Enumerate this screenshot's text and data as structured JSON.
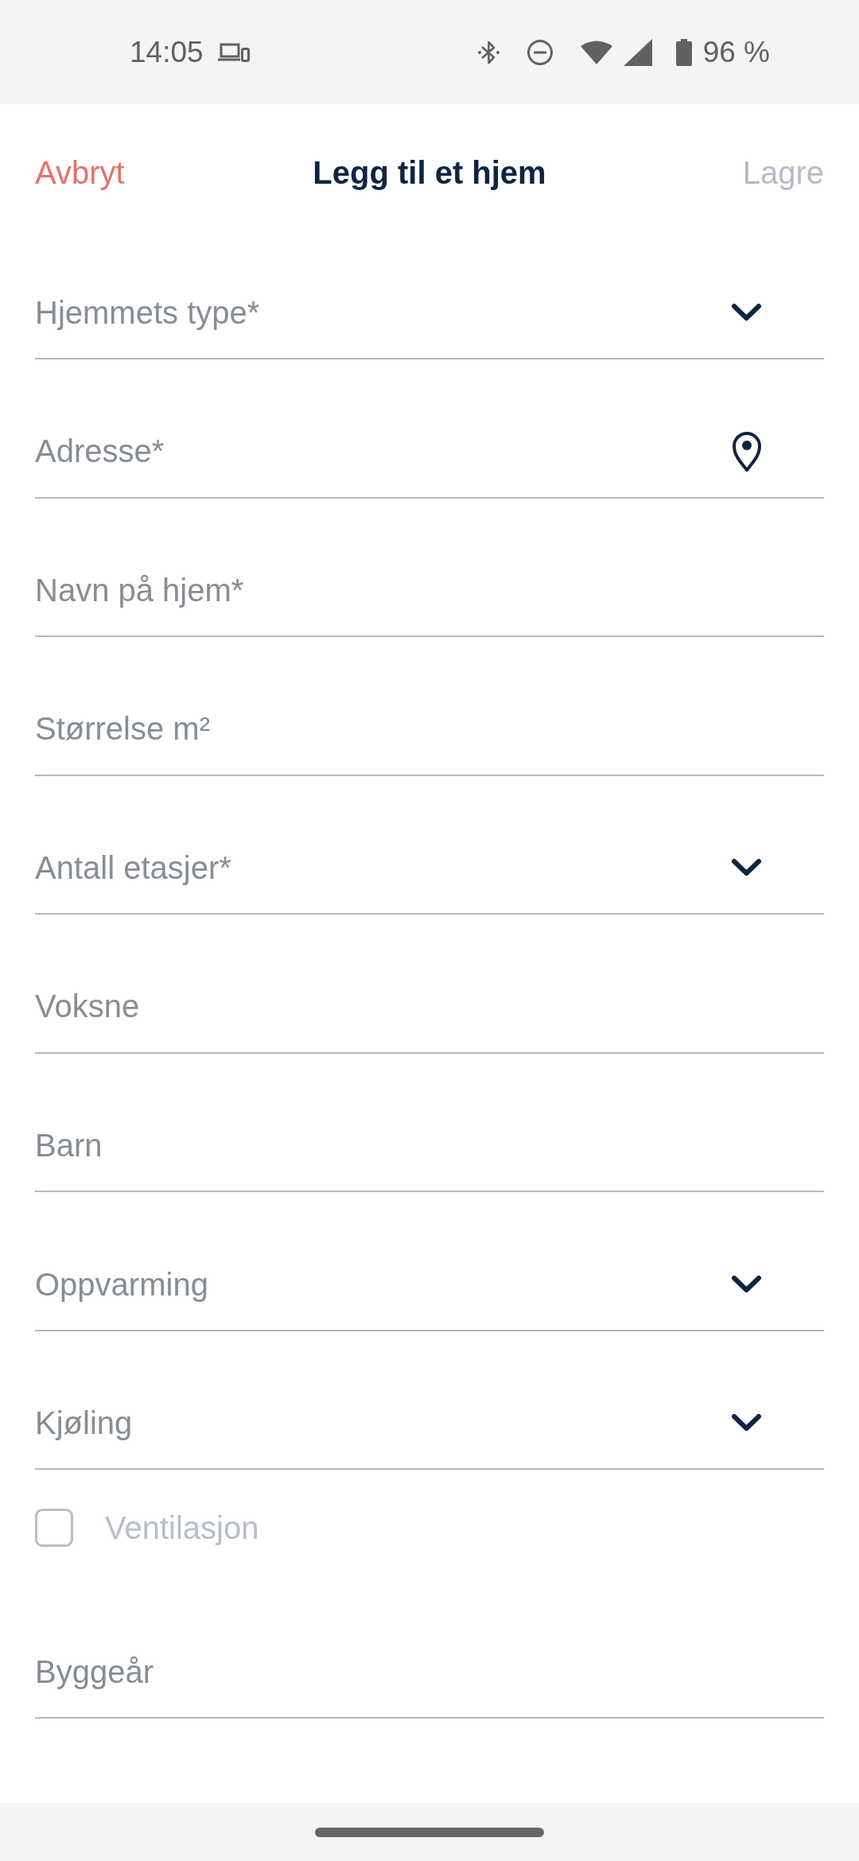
{
  "status_bar": {
    "time": "14:05",
    "battery": "96 %"
  },
  "header": {
    "cancel": "Avbryt",
    "title": "Legg til et hjem",
    "save": {
      "label": "Lagre",
      "disabled": true
    }
  },
  "fields": [
    {
      "kind": "dropdown",
      "placeholder": "Hjemmets type*"
    },
    {
      "kind": "location",
      "placeholder": "Adresse*"
    },
    {
      "kind": "text",
      "placeholder": "Navn på hjem*"
    },
    {
      "kind": "text",
      "placeholder": "Størrelse m²"
    },
    {
      "kind": "dropdown",
      "placeholder": "Antall etasjer*"
    },
    {
      "kind": "text",
      "placeholder": "Voksne"
    },
    {
      "kind": "text",
      "placeholder": "Barn"
    },
    {
      "kind": "dropdown",
      "placeholder": "Oppvarming"
    },
    {
      "kind": "dropdown",
      "placeholder": "Kjøling"
    },
    {
      "kind": "checkbox",
      "label": "Ventilasjon",
      "checked": false
    },
    {
      "kind": "text",
      "placeholder": "Byggeår"
    }
  ]
}
